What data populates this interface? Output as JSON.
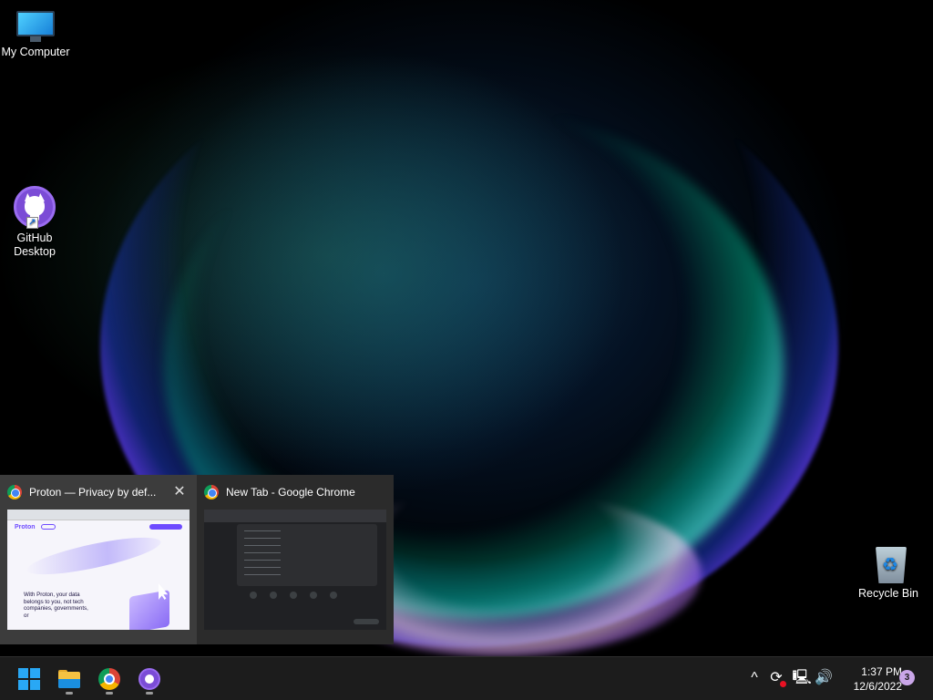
{
  "desktop": {
    "icons": {
      "my_computer": {
        "label": "My Computer",
        "icon": "monitor-icon"
      },
      "github_desktop": {
        "label": "GitHub Desktop",
        "icon": "github-desktop-icon"
      },
      "recycle_bin": {
        "label": "Recycle Bin",
        "icon": "recycle-bin-icon"
      }
    }
  },
  "preview": {
    "windows": [
      {
        "title": "Proton — Privacy by def...",
        "icon": "chrome-icon",
        "close_label": "✕",
        "page_brand": "Proton",
        "page_hero": "With Proton, your data belongs to you, not tech companies, governments, or"
      },
      {
        "title": "New Tab - Google Chrome",
        "icon": "chrome-icon"
      }
    ]
  },
  "taskbar": {
    "apps": [
      "start-icon",
      "file-explorer-icon",
      "chrome-icon",
      "github-desktop-icon"
    ],
    "tray": {
      "overflow": "^",
      "time": "1:37 PM",
      "date": "12/6/2022",
      "notifications": "3"
    }
  },
  "colors": {
    "accent": "#29a8f5",
    "github": "#7b4cd6",
    "taskbar": "#1c1c1c",
    "alert": "#e81123"
  }
}
